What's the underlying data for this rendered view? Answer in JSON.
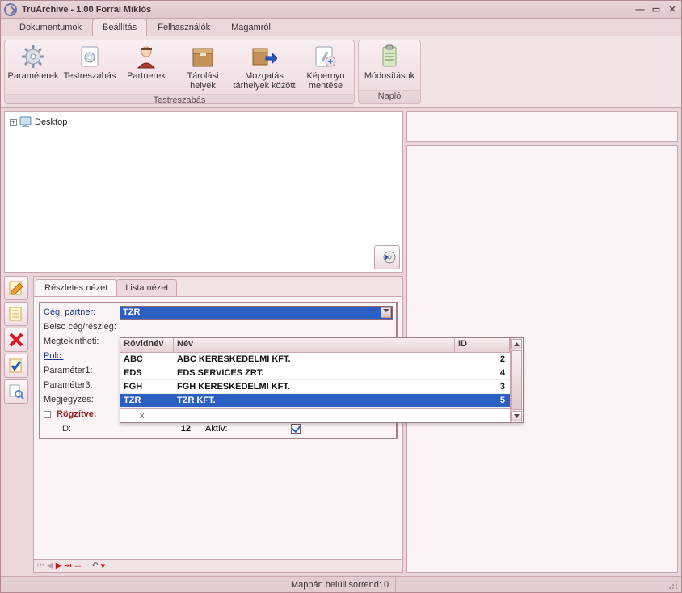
{
  "window": {
    "title": "TruArchive - 1.00 Forrai Miklós"
  },
  "menus": [
    "Dokumentumok",
    "Beállítás",
    "Felhasználók",
    "Magamról"
  ],
  "menuActiveIndex": 1,
  "ribbon": {
    "groups": [
      {
        "label": "Testreszabás",
        "items": [
          {
            "label": "Paraméterek",
            "icon": "gear"
          },
          {
            "label": "Testreszabás",
            "icon": "gear-doc"
          },
          {
            "label": "Partnerek",
            "icon": "person"
          },
          {
            "label": "Tárolási helyek",
            "icon": "box"
          },
          {
            "label": "Mozgatás tárhelyek között",
            "icon": "box-arrow"
          },
          {
            "label": "Képernyo mentése",
            "icon": "screen-save"
          }
        ]
      },
      {
        "label": "Napló",
        "items": [
          {
            "label": "Módosítások",
            "icon": "clipboard"
          }
        ]
      }
    ]
  },
  "tree": {
    "root": "Desktop"
  },
  "detailTabs": [
    "Részletes nézet",
    "Lista nézet"
  ],
  "detailTabActive": 0,
  "fields": {
    "ceg_partner_label": "Cég, partner:",
    "ceg_partner_value": "TZR",
    "belso_label": "Belso cég/részleg:",
    "megtekint_label": "Megtekintheti:",
    "polc_label": "Polc:",
    "param1_label": "Paraméter1:",
    "param3_label": "Paraméter3:",
    "megjegyzes_label": "Megjegyzés:",
    "rogzitve_label": "Rögzítve:",
    "id_label": "ID:",
    "id_value": "12",
    "aktiv_label": "Aktív:",
    "aktiv_checked": true
  },
  "dropdown": {
    "headers": {
      "col1": "Rövidnév",
      "col2": "Név",
      "col3": "ID"
    },
    "rows": [
      {
        "short": "ABC",
        "name": "ABC KERESKEDELMI KFT.",
        "id": "2",
        "sel": false
      },
      {
        "short": "EDS",
        "name": "EDS SERVICES ZRT.",
        "id": "4",
        "sel": false
      },
      {
        "short": "FGH",
        "name": "FGH KERESKEDELMI KFT.",
        "id": "3",
        "sel": false
      },
      {
        "short": "TZR",
        "name": "TZR KFT.",
        "id": "5",
        "sel": true
      }
    ],
    "footer_x": "x"
  },
  "status": {
    "sortend": "Mappán belüli sorrend: 0"
  }
}
